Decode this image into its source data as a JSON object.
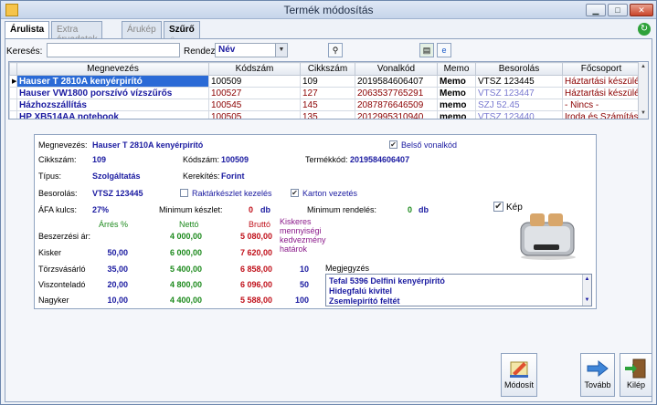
{
  "window": {
    "title": "Termék módosítás"
  },
  "tabs": [
    {
      "label": "Árulista",
      "active": true
    },
    {
      "label": "Extra áruadatok",
      "active": false
    },
    {
      "label": "Árukép",
      "active": false
    },
    {
      "label": "Szűrő",
      "active": false
    }
  ],
  "toolbar": {
    "search_label": "Keresés:",
    "search_value": "",
    "sort_label": "Rendez:",
    "sort_value": "Név"
  },
  "grid": {
    "columns": [
      "Megnevezés",
      "Kódszám",
      "Cikkszám",
      "Vonalkód",
      "Memo",
      "Besorolás",
      "Főcsoport"
    ],
    "rows": [
      {
        "name": "Hauser T 2810A kenyérpirító",
        "code": "100509",
        "sku": "109",
        "barcode": "2019584606407",
        "memo": "Memo",
        "class": "VTSZ 123445",
        "group": "Háztartási készülék"
      },
      {
        "name": "Hauser VW1800 porszívó vízszűrős",
        "code": "100527",
        "sku": "127",
        "barcode": "2063537765291",
        "memo": "Memo",
        "class": "VTSZ 123447",
        "group": "Háztartási készülék"
      },
      {
        "name": "Házhozszállítás",
        "code": "100545",
        "sku": "145",
        "barcode": "2087876646509",
        "memo": "memo",
        "class": "SZJ 52.45",
        "group": "- Nincs -"
      },
      {
        "name": "HP XB514AA notebook",
        "code": "100505",
        "sku": "135",
        "barcode": "2012995310940",
        "memo": "memo",
        "class": "VTSZ 123440",
        "group": "Iroda és Számítástech"
      }
    ]
  },
  "detail": {
    "name_label": "Megnevezés:",
    "name_value": "Hauser T 2810A kenyérpirító",
    "internal_barcode_label": "Belső vonalkód",
    "sku_label": "Cikkszám:",
    "sku_value": "109",
    "code_label": "Kódszám:",
    "code_value": "100509",
    "product_code_label": "Termékkód:",
    "product_code_value": "2019584606407",
    "type_label": "Típus:",
    "type_value": "Szolgáltatás",
    "rounding_label": "Kerekítés:",
    "rounding_value": "Forint",
    "class_label": "Besorolás:",
    "class_value": "VTSZ 123445",
    "stock_mgmt_label": "Raktárkészlet kezelés",
    "carton_label": "Karton vezetés",
    "vat_label": "ÁFA kulcs:",
    "vat_value": "27%",
    "min_stock_label": "Minimum készlet:",
    "min_stock_value": "0",
    "min_stock_unit": "db",
    "min_order_label": "Minimum rendelés:",
    "min_order_value": "0",
    "min_order_unit": "db",
    "image_label": "Kép",
    "price_headers": {
      "margin": "Árrés %",
      "net": "Nettó",
      "gross": "Bruttó",
      "discount": "Kiskeres mennyiségi kedvezmény határok"
    },
    "prices": [
      {
        "label": "Beszerzési ár:",
        "margin": "",
        "net": "4 000,00",
        "gross": "5 080,00",
        "disc": ""
      },
      {
        "label": "Kisker",
        "margin": "50,00",
        "net": "6 000,00",
        "gross": "7 620,00",
        "disc": ""
      },
      {
        "label": "Törzsvásárló",
        "margin": "35,00",
        "net": "5 400,00",
        "gross": "6 858,00",
        "disc": "10"
      },
      {
        "label": "Viszonteladó",
        "margin": "20,00",
        "net": "4 800,00",
        "gross": "6 096,00",
        "disc": "50"
      },
      {
        "label": "Nagyker",
        "margin": "10,00",
        "net": "4 400,00",
        "gross": "5 588,00",
        "disc": "100"
      }
    ],
    "notes_label": "Megjegyzés",
    "notes": [
      "Tefal 5396 Delfini kenyérpirító",
      "Hidegfalú kivitel",
      "Zsemlepirító feltét"
    ]
  },
  "buttons": {
    "modify": "Módosít",
    "next": "Tovább",
    "exit": "Kilép"
  },
  "colors": {
    "selection": "#2a6ad6",
    "product_name": "#1a1aa0",
    "net_price": "#1d8a1d",
    "gross_price": "#c0101a"
  }
}
